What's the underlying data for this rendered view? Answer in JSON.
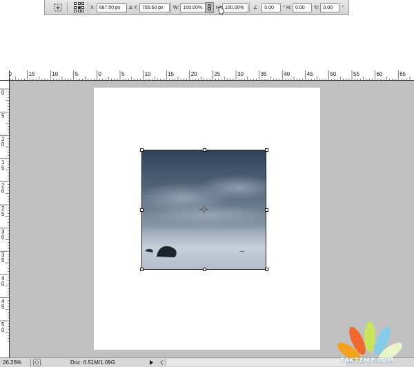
{
  "options_bar": {
    "x": {
      "label": "X:",
      "value": "687.50 px"
    },
    "y": {
      "label": "Y:",
      "value": "755.50 px"
    },
    "w": {
      "label": "W:",
      "value": "100.00%"
    },
    "h": {
      "label": "H:",
      "value": "100.00%"
    },
    "rotate": {
      "value": "0.00",
      "unit": "°"
    },
    "skew_h": {
      "label": "H:",
      "value": "0.00",
      "unit": "°"
    },
    "skew_v": {
      "label": "V:",
      "value": "0.00",
      "unit": "°"
    },
    "delta_symbol": "Δ",
    "angle_symbol": "∠"
  },
  "ruler_top": {
    "labels": [
      "10",
      "15",
      "10",
      "5",
      "0",
      "5",
      "10",
      "15",
      "20",
      "25",
      "30",
      "35",
      "40",
      "45",
      "50",
      "55",
      "60",
      "65"
    ]
  },
  "ruler_left": {
    "labels": [
      "0",
      "5",
      "1 0",
      "1 5",
      "2 0",
      "2 5",
      "3 0",
      "3 5",
      "4 0",
      "4 5",
      "5 0"
    ]
  },
  "status_bar": {
    "zoom": "26.26%",
    "doc_info": "Doc: 6.51M/1.09G"
  },
  "watermark": {
    "text": "TAKTEMP.COM"
  },
  "colors": {
    "workspace": "#c0c0c0",
    "document": "#ffffff",
    "toolbar": "#d8d8d8",
    "sky_top": "#2f4259",
    "sea": "#aab6c4"
  },
  "icons": {
    "move_tool": "move-tool-icon",
    "reference_point": "reference-point-icon",
    "link": "link-icon",
    "hand_cursor": "hand-cursor-icon",
    "pivot": "pivot-crosshair-icon"
  }
}
